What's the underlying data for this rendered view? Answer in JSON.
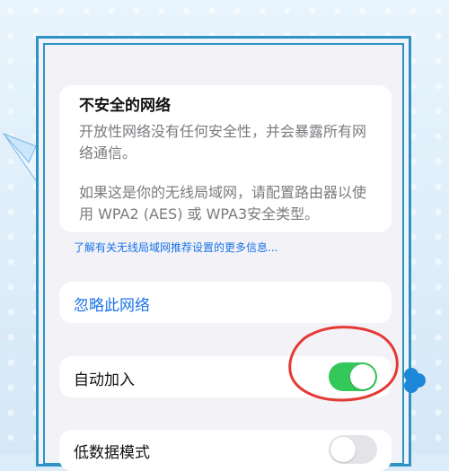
{
  "warning": {
    "title": "不安全的网络",
    "text1": "开放性网络没有任何安全性，并会暴露所有网络通信。",
    "text2": "如果这是你的无线局域网，请配置路由器以使用 WPA2 (AES) 或 WPA3安全类型。"
  },
  "link": {
    "label": "了解有关无线局域网推荐设置的更多信息..."
  },
  "forget": {
    "label": "忽略此网络"
  },
  "autojoin": {
    "label": "自动加入",
    "toggle_state": "on"
  },
  "lowdata": {
    "label": "低数据模式",
    "toggle_state": "off"
  },
  "decor": {
    "plane_icon": "paper-plane-icon",
    "cloud_icon": "cloud-icon",
    "annotation": "red-circle-annotation"
  }
}
